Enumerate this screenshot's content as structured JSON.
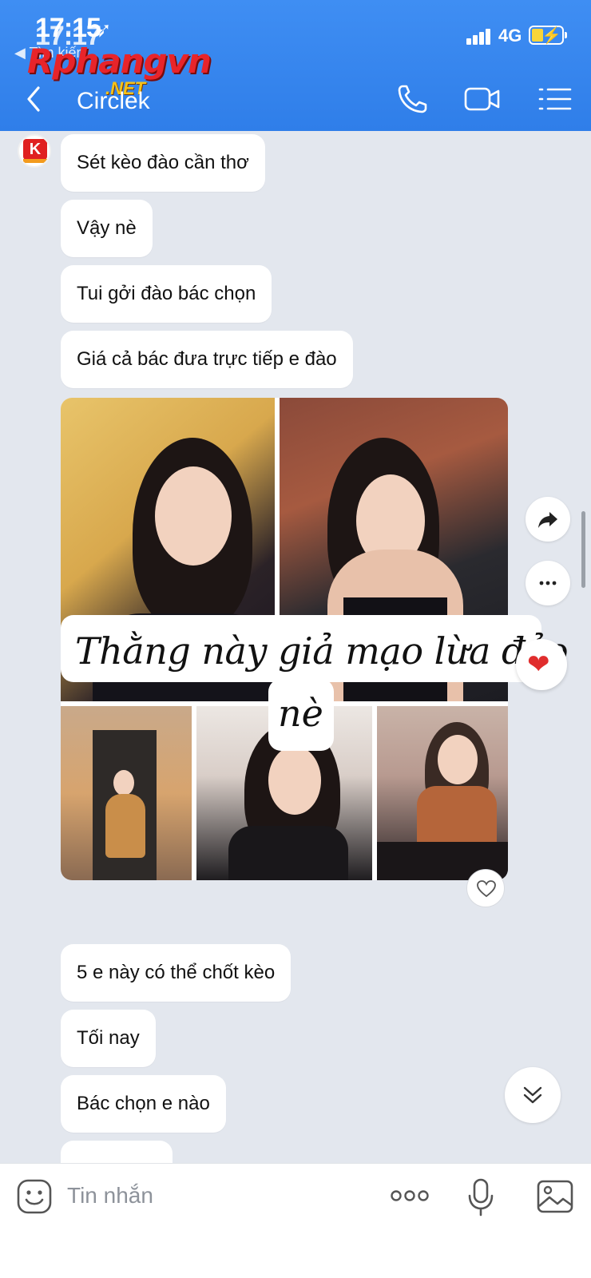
{
  "status_bar": {
    "time": "17:15",
    "time_overlap": "17:17",
    "back_app_label": "◀ Tìm kiếm",
    "network": "4G"
  },
  "watermark": {
    "brand": "Rphangvn",
    "suffix": ".NET"
  },
  "header": {
    "title": "Circlek",
    "accent": "#3a88f0"
  },
  "messages_before": [
    "Sét kèo đào cần thơ",
    "Vậy nè",
    "Tui gởi đào bác chọn",
    "Giá cả bác đưa trực tiếp e đào"
  ],
  "overlay_caption": {
    "line1": "Thằng này giả mạo lừa đảo",
    "line2": "nè"
  },
  "messages_after": [
    "5 e này có thể chốt kèo",
    "Tối nay",
    "Bác chọn e nào"
  ],
  "input": {
    "placeholder": "Tin nhắn"
  },
  "icons": {
    "back": "chevron-left-icon",
    "call": "phone-icon",
    "video": "video-camera-icon",
    "menu": "list-menu-icon",
    "share": "forward-arrow-icon",
    "more": "ellipsis-icon",
    "like": "heart-icon",
    "scroll": "double-chevron-down-icon",
    "emoji": "sticker-icon",
    "mic": "microphone-icon",
    "image": "image-icon"
  }
}
